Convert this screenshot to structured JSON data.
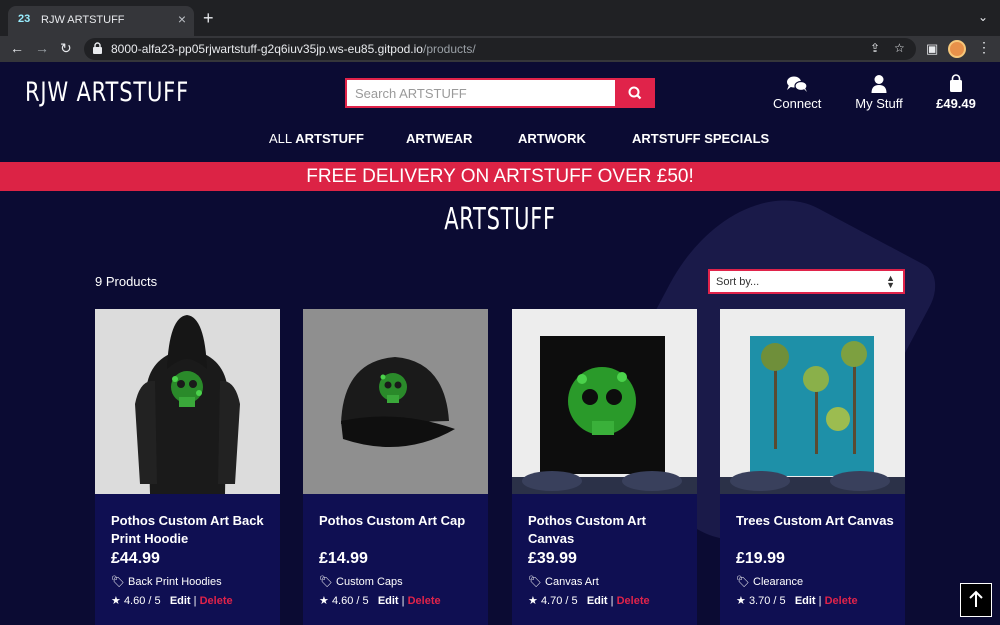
{
  "browser": {
    "tab_title": "RJW ARTSTUFF",
    "favicon_text": "23",
    "url_main": "8000-alfa23-pp05rjwartstuff-g2q6iuv35jp.ws-eu85.gitpod.io",
    "url_path": "/products/"
  },
  "header": {
    "logo": "RJW ARTSTUFF",
    "search_placeholder": "Search ARTSTUFF",
    "connect_label": "Connect",
    "mystuff_label": "My Stuff",
    "bag_total": "£49.49"
  },
  "nav": {
    "all_prefix": "ALL",
    "all_label": "ARTSTUFF",
    "artwear": "ARTWEAR",
    "artwork": "ARTWORK",
    "specials": "ARTSTUFF SPECIALS"
  },
  "promo": "FREE DELIVERY ON ARTSTUFF OVER £50!",
  "page": {
    "heading": "ARTSTUFF",
    "count": "9 Products",
    "sort_value": "Sort by..."
  },
  "products": [
    {
      "title": "Pothos Custom Art Back Print Hoodie",
      "price": "£44.99",
      "category": "Back Print Hoodies",
      "rating": "4.60 / 5"
    },
    {
      "title": "Pothos Custom Art Cap",
      "price": "£14.99",
      "category": "Custom Caps",
      "rating": "4.60 / 5"
    },
    {
      "title": "Pothos Custom Art Canvas",
      "price": "£39.99",
      "category": "Canvas Art",
      "rating": "4.70 / 5"
    },
    {
      "title": "Trees Custom Art Canvas",
      "price": "£19.99",
      "category": "Clearance",
      "rating": "3.70 / 5"
    }
  ],
  "actions": {
    "edit": "Edit",
    "sep": "|",
    "delete": "Delete"
  },
  "colors": {
    "brand": "#dc2345",
    "background": "#0b0b33",
    "card": "#0f0f52"
  }
}
